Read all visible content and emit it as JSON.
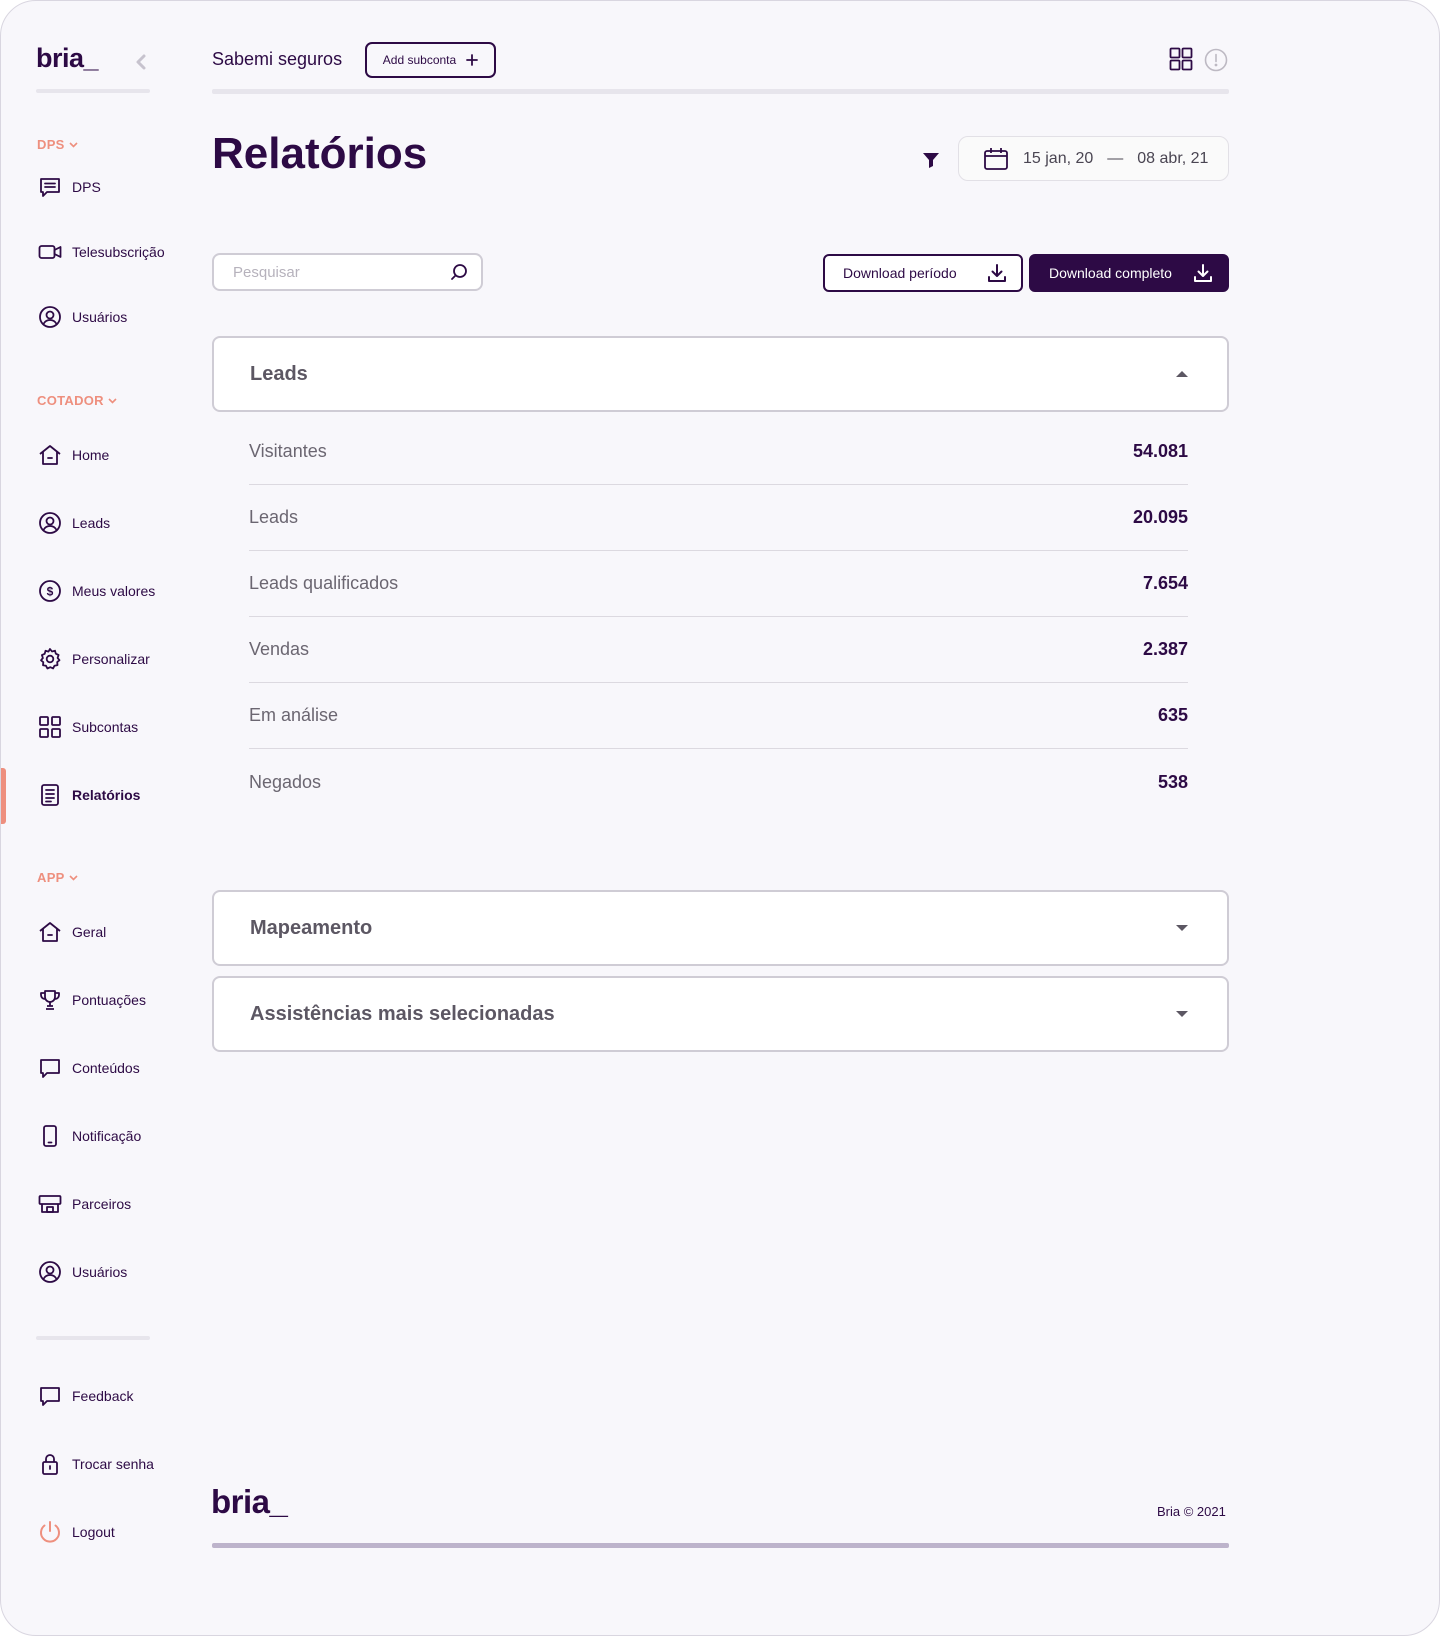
{
  "brand": {
    "logo": "bria_"
  },
  "sidebar": {
    "sections": [
      {
        "label": "DPS",
        "items": [
          {
            "label": "DPS",
            "icon": "message-lines-icon"
          },
          {
            "label": "Telesubscrição",
            "icon": "video-camera-icon"
          },
          {
            "label": "Usuários",
            "icon": "user-circle-icon"
          }
        ]
      },
      {
        "label": "COTADOR",
        "items": [
          {
            "label": "Home",
            "icon": "home-icon"
          },
          {
            "label": "Leads",
            "icon": "user-circle-icon"
          },
          {
            "label": "Meus valores",
            "icon": "dollar-circle-icon"
          },
          {
            "label": "Personalizar",
            "icon": "gear-icon"
          },
          {
            "label": "Subcontas",
            "icon": "grid-icon"
          },
          {
            "label": "Relatórios",
            "icon": "document-icon",
            "active": true
          }
        ]
      },
      {
        "label": "APP",
        "items": [
          {
            "label": "Geral",
            "icon": "home-icon"
          },
          {
            "label": "Pontuações",
            "icon": "trophy-icon"
          },
          {
            "label": "Conteúdos",
            "icon": "chat-bubble-icon"
          },
          {
            "label": "Notificação",
            "icon": "phone-icon"
          },
          {
            "label": "Parceiros",
            "icon": "store-icon"
          },
          {
            "label": "Usuários",
            "icon": "user-circle-icon"
          }
        ]
      }
    ],
    "bottom": [
      {
        "label": "Feedback",
        "icon": "chat-bubble-icon"
      },
      {
        "label": "Trocar senha",
        "icon": "lock-icon"
      },
      {
        "label": "Logout",
        "icon": "power-icon"
      }
    ]
  },
  "header": {
    "account": "Sabemi seguros",
    "add_subconta": "Add subconta"
  },
  "page": {
    "title": "Relatórios",
    "date_start": "15 jan, 20",
    "date_sep": "—",
    "date_end": "08 abr, 21"
  },
  "toolbar": {
    "search_placeholder": "Pesquisar",
    "download_period": "Download período",
    "download_full": "Download completo"
  },
  "leads": {
    "title": "Leads",
    "rows": [
      {
        "label": "Visitantes",
        "value": "54.081"
      },
      {
        "label": "Leads",
        "value": "20.095"
      },
      {
        "label": "Leads qualificados",
        "value": "7.654"
      },
      {
        "label": "Vendas",
        "value": "2.387"
      },
      {
        "label": "Em análise",
        "value": "635"
      },
      {
        "label": "Negados",
        "value": "538"
      }
    ]
  },
  "accordions": {
    "mapeamento": "Mapeamento",
    "assistencias": "Assistências mais selecionadas"
  },
  "footer": {
    "logo": "bria_",
    "copyright": "Bria © 2021"
  },
  "colors": {
    "primary": "#2d0a45",
    "accent": "#ee8f7e",
    "muted": "#cfccd5"
  }
}
